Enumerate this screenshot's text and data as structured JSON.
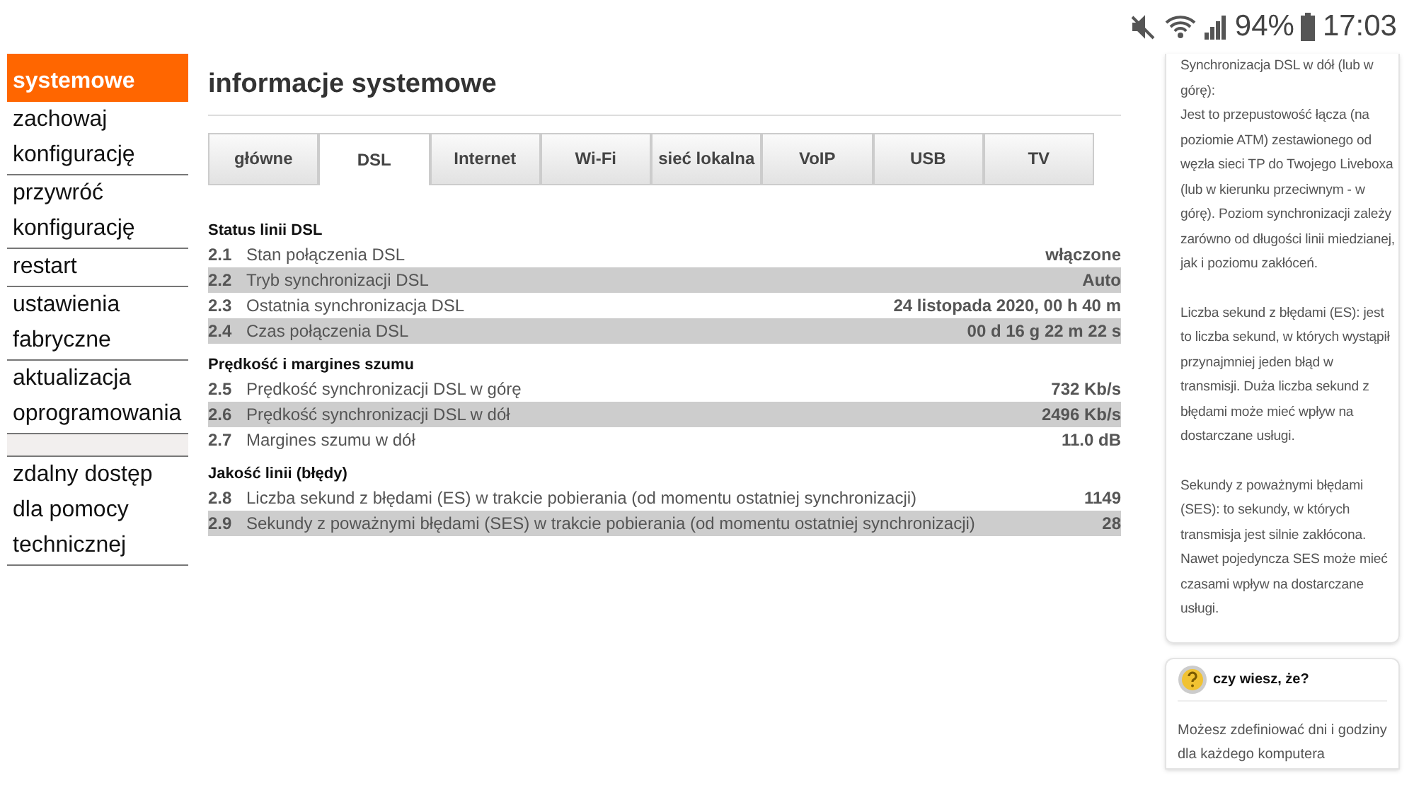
{
  "status_bar": {
    "battery": "94%",
    "time": "17:03"
  },
  "sidebar": {
    "items": [
      {
        "label": "systemowe",
        "selected": true,
        "kind": "link"
      },
      {
        "label": "zachowaj konfigurację",
        "selected": false,
        "kind": "link"
      },
      {
        "label": "przywróć konfigurację",
        "selected": false,
        "kind": "link"
      },
      {
        "label": "restart",
        "selected": false,
        "kind": "link"
      },
      {
        "label": "ustawienia fabryczne",
        "selected": false,
        "kind": "link"
      },
      {
        "label": "aktualizacja oprogramowania",
        "selected": false,
        "kind": "link"
      },
      {
        "kind": "spacer"
      },
      {
        "label": "zdalny dostęp dla pomocy technicznej",
        "selected": false,
        "kind": "link"
      }
    ]
  },
  "page": {
    "title": "informacje systemowe",
    "tabs": [
      {
        "label": "główne",
        "selected": false
      },
      {
        "label": "DSL",
        "selected": true
      },
      {
        "label": "Internet",
        "selected": false
      },
      {
        "label": "Wi-Fi",
        "selected": false
      },
      {
        "label": "sieć lokalna",
        "selected": false
      },
      {
        "label": "VoIP",
        "selected": false
      },
      {
        "label": "USB",
        "selected": false
      },
      {
        "label": "TV",
        "selected": false
      }
    ],
    "sections": [
      {
        "title": "Status linii DSL",
        "rows": [
          {
            "number": "2.1",
            "label": "Stan połączenia DSL",
            "value": "włączone"
          },
          {
            "number": "2.2",
            "label": "Tryb synchronizacji DSL",
            "value": "Auto"
          },
          {
            "number": "2.3",
            "label": "Ostatnia synchronizacja DSL",
            "value": "24 listopada 2020, 00 h 40 m"
          },
          {
            "number": "2.4",
            "label": "Czas połączenia DSL",
            "value": "00 d 16 g 22 m 22 s"
          }
        ]
      },
      {
        "title": "Prędkość i margines szumu",
        "rows": [
          {
            "number": "2.5",
            "label": "Prędkość synchronizacji DSL w górę",
            "value": "732 Kb/s"
          },
          {
            "number": "2.6",
            "label": "Prędkość synchronizacji DSL w dół",
            "value": "2496 Kb/s"
          },
          {
            "number": "2.7",
            "label": "Margines szumu w dół",
            "value": "11.0 dB"
          }
        ]
      },
      {
        "title": "Jakość linii (błędy)",
        "rows": [
          {
            "number": "2.8",
            "label": "Liczba sekund z błędami (ES) w trakcie pobierania (od momentu ostatniej synchronizacji)",
            "value": "1149"
          },
          {
            "number": "2.9",
            "label": "Sekundy z poważnymi błędami (SES) w trakcie pobierania (od momentu ostatniej synchronizacji)",
            "value": "28"
          }
        ]
      }
    ]
  },
  "help": {
    "paragraphs": [
      [
        "Synchronizacja DSL w dół (lub w górę):",
        "Jest to przepustowość łącza (na poziomie ATM) zestawionego od węzła sieci TP do Twojego Liveboxa (lub w kierunku przeciwnym - w górę). Poziom synchronizacji zależy zarówno od długości linii miedzianej, jak i poziomu zakłóceń."
      ],
      [
        "Liczba sekund z błędami (ES): jest to liczba sekund, w których wystąpił przynajmniej jeden błąd w transmisji. Duża liczba sekund z błędami może mieć wpływ na dostarczane usługi."
      ],
      [
        "Sekundy z poważnymi błędami (SES): to sekundy, w których transmisja jest silnie zakłócona. Nawet pojedyncza SES może mieć czasami wpływ na dostarczane usługi."
      ]
    ]
  },
  "tip": {
    "title": "czy wiesz, że?",
    "text": "Możesz zdefiniować dni i godziny dla każdego komputera"
  }
}
